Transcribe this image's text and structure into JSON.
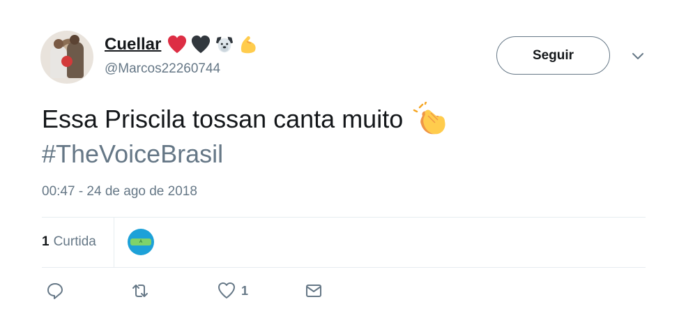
{
  "user": {
    "display_name": "Cuellar",
    "handle": "@Marcos22260744",
    "name_emojis": [
      "red-heart-emoji",
      "black-heart-emoji",
      "dog-face-emoji",
      "flexed-biceps-emoji"
    ]
  },
  "follow_button": {
    "label": "Seguir"
  },
  "tweet": {
    "text": "Essa Priscila tossan canta muito",
    "text_emoji": "clapping-hands-emoji",
    "hashtag": "#TheVoiceBrasil",
    "timestamp": "00:47 - 24 de ago de 2018"
  },
  "stats": {
    "likes_count": "1",
    "likes_label": "Curtida"
  },
  "liker": {
    "avatar_text": "A FAZENDA"
  },
  "actions": {
    "reply": {
      "icon": "reply-icon"
    },
    "retweet": {
      "icon": "retweet-icon"
    },
    "like": {
      "icon": "heart-icon",
      "count": "1"
    },
    "dm": {
      "icon": "envelope-icon"
    }
  },
  "colors": {
    "text": "#14171a",
    "secondary": "#657786",
    "divider": "#e6ecf0",
    "emoji_yellow": "#f5c33b"
  }
}
